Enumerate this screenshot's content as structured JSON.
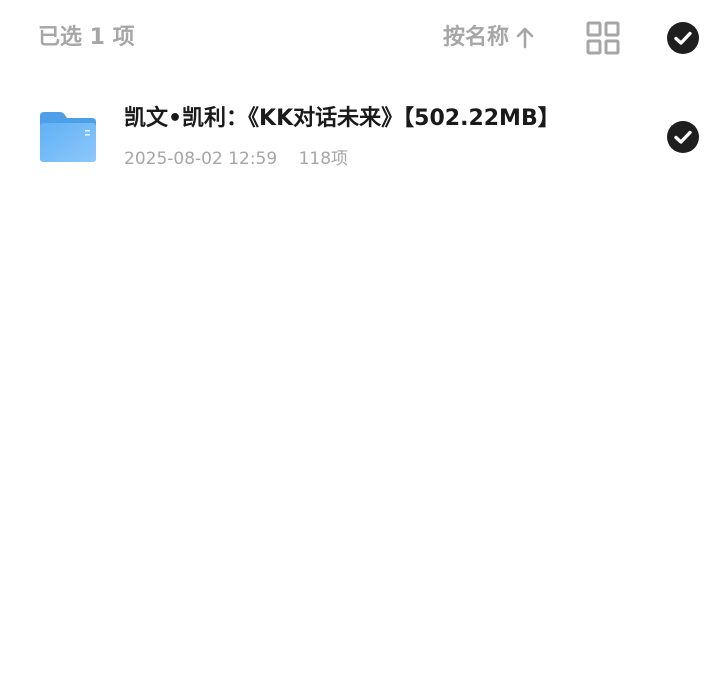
{
  "header": {
    "selected_label": "已选 1 项",
    "sort_label": "按名称",
    "sort_icon": "arrow-up-icon",
    "view_toggle_icon": "grid-view-icon",
    "select_all_icon": "check-circle-icon"
  },
  "files": [
    {
      "name": "凯文•凯利：《KK对话未来》【502.22MB】",
      "date": "2025-08-02 12:59",
      "count": "118项",
      "icon": "folder-icon",
      "selected": true
    }
  ],
  "colors": {
    "header_text": "#a6a6a6",
    "file_name": "#1a1a1a",
    "meta_text": "#a6a6a6",
    "check_fill": "#1f1f1f",
    "folder_blue": "#5aa7f0"
  }
}
